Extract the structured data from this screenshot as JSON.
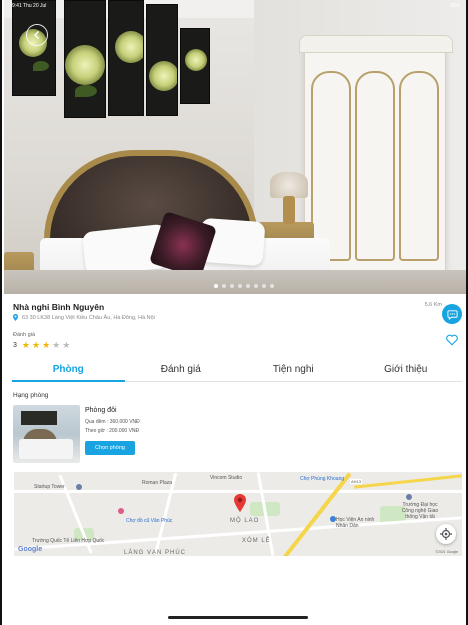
{
  "status": {
    "time": "9:41",
    "date": "Thu 20 Jul",
    "battery": "55%"
  },
  "gallery": {
    "active_index": 0,
    "count": 8
  },
  "hotel": {
    "name": "Nhà nghỉ Bình Nguyên",
    "distance": "5.6 Km",
    "address": "63 30 LK38 Làng Việt Kiều Châu Âu, Hà Đông, Hà Nội",
    "rating_label": "Đánh giá",
    "rating_value": "3",
    "rating": 3,
    "rating_max": 5
  },
  "tabs": [
    {
      "label": "Phòng",
      "active": true
    },
    {
      "label": "Đánh giá",
      "active": false
    },
    {
      "label": "Tiện nghi",
      "active": false
    },
    {
      "label": "Giới thiệu",
      "active": false
    }
  ],
  "rooms": {
    "section_title": "Hạng phòng",
    "items": [
      {
        "name": "Phòng đôi",
        "price_overnight": "Qua đêm : 360.000 VNĐ",
        "price_hourly": "Theo giờ : 200.000 VNĐ",
        "choose_label": "Chọn phòng"
      }
    ]
  },
  "map": {
    "labels": {
      "startup_tower": "Startup Tower",
      "roman_plaza": "Roman Plaza",
      "vincom": "Vincom Studio",
      "cho_phung_khoang": "Chợ Phùng Khoang",
      "cho_do_cu": "Chợ đồ cũ Văn Phúc",
      "mo_lao": "MỘ LAO",
      "xom_le": "XÓM LÊ",
      "hoc_vien": "Học Viện An ninh Nhân Dân",
      "truong_dai_hoc": "Trường Đại học Công nghệ Giao thông Vận tải",
      "truong_quoc_te": "Trường Quốc Tế Liên Hợp Quốc",
      "lang_van_phuc": "LÀNG VẠN PHÚC",
      "road_code": "AH13",
      "google": "Google",
      "copyright": "©2021 Google"
    }
  },
  "colors": {
    "accent": "#18a4e0",
    "star": "#f2b705",
    "star_off": "#bcbcbc"
  },
  "icons": {
    "back": "arrow-left-icon",
    "chat": "chat-bubble-icon",
    "favorite": "heart-icon",
    "location": "map-pin-icon",
    "locate": "crosshair-icon"
  }
}
